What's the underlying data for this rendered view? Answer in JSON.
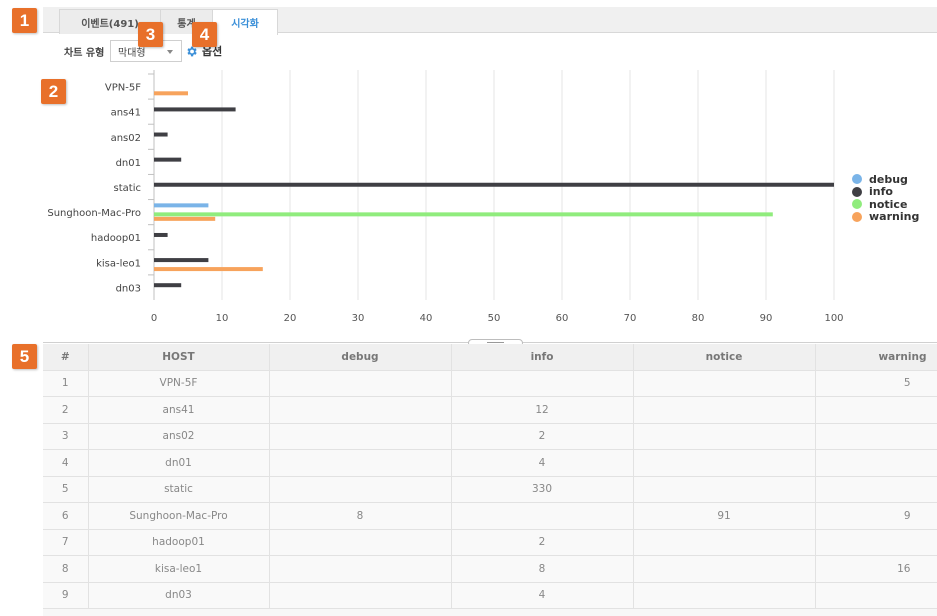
{
  "tabs": [
    {
      "label": "이벤트(491)",
      "active": false
    },
    {
      "label": "통계",
      "active": false
    },
    {
      "label": "시각화",
      "active": true
    }
  ],
  "controls": {
    "chart_type_label": "차트 유형",
    "chart_type_value": "막대형",
    "options_label": "옵션"
  },
  "callouts": [
    "1",
    "2",
    "3",
    "4",
    "5"
  ],
  "colors": {
    "debug": "#7ab4e8",
    "info": "#3f3f44",
    "notice": "#90ec7d",
    "warning": "#f7a35c",
    "accent": "#3a8fd8",
    "badge": "#e8702a"
  },
  "chart_data": {
    "type": "bar",
    "orientation": "horizontal",
    "categories": [
      "VPN-5F",
      "ans41",
      "ans02",
      "dn01",
      "static",
      "Sunghoon-Mac-Pro",
      "hadoop01",
      "kisa-leo1",
      "dn03"
    ],
    "series": [
      {
        "name": "debug",
        "values": [
          null,
          null,
          null,
          null,
          null,
          8,
          null,
          null,
          null
        ]
      },
      {
        "name": "info",
        "values": [
          null,
          12,
          2,
          4,
          330,
          null,
          2,
          8,
          4
        ]
      },
      {
        "name": "notice",
        "values": [
          null,
          null,
          null,
          null,
          null,
          91,
          null,
          null,
          null
        ]
      },
      {
        "name": "warning",
        "values": [
          5,
          null,
          null,
          null,
          null,
          9,
          null,
          16,
          null
        ]
      }
    ],
    "xlim": [
      0,
      100
    ],
    "xticks": [
      "0",
      "10",
      "20",
      "30",
      "40",
      "50",
      "60",
      "70",
      "80",
      "90",
      "100"
    ],
    "grid": true,
    "legend_position": "right"
  },
  "table": {
    "headers": [
      "#",
      "HOST",
      "debug",
      "info",
      "notice",
      "warning"
    ],
    "rows": [
      [
        "1",
        "VPN-5F",
        "",
        "",
        "",
        "5"
      ],
      [
        "2",
        "ans41",
        "",
        "12",
        "",
        ""
      ],
      [
        "3",
        "ans02",
        "",
        "2",
        "",
        ""
      ],
      [
        "4",
        "dn01",
        "",
        "4",
        "",
        ""
      ],
      [
        "5",
        "static",
        "",
        "330",
        "",
        ""
      ],
      [
        "6",
        "Sunghoon-Mac-Pro",
        "8",
        "",
        "91",
        "9"
      ],
      [
        "7",
        "hadoop01",
        "",
        "2",
        "",
        ""
      ],
      [
        "8",
        "kisa-leo1",
        "",
        "8",
        "",
        "16"
      ],
      [
        "9",
        "dn03",
        "",
        "4",
        "",
        ""
      ]
    ]
  }
}
